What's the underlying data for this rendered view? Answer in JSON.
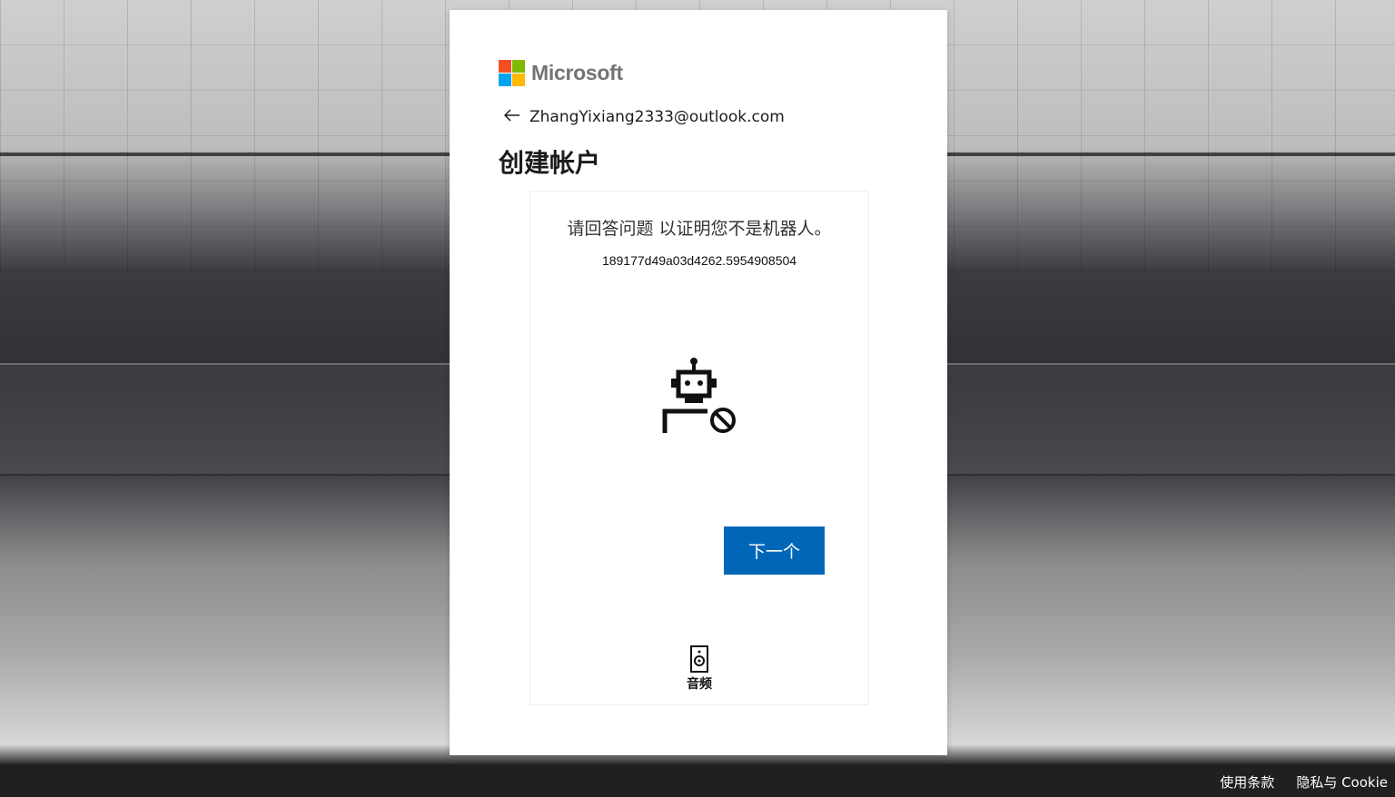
{
  "brand": {
    "name": "Microsoft",
    "colors": {
      "red": "#f25022",
      "green": "#7fba00",
      "blue": "#00a4ef",
      "yellow": "#ffb900"
    }
  },
  "identity": {
    "back_icon": "arrow-left-icon",
    "email": "ZhangYixiang2333@outlook.com"
  },
  "page": {
    "title": "创建帐户"
  },
  "challenge": {
    "question": "请回答问题 以证明您不是机器人。",
    "session_id": "189177d49a03d4262.5954908504",
    "icon": "robot-blocked-icon",
    "next_label": "下一个",
    "audio_icon": "speaker-icon",
    "audio_label": "音频"
  },
  "footer": {
    "terms": "使用条款",
    "privacy": "隐私与 Cookie"
  },
  "colors": {
    "primary_button": "#0067b8",
    "footer_bg": "#1e1e1e"
  }
}
